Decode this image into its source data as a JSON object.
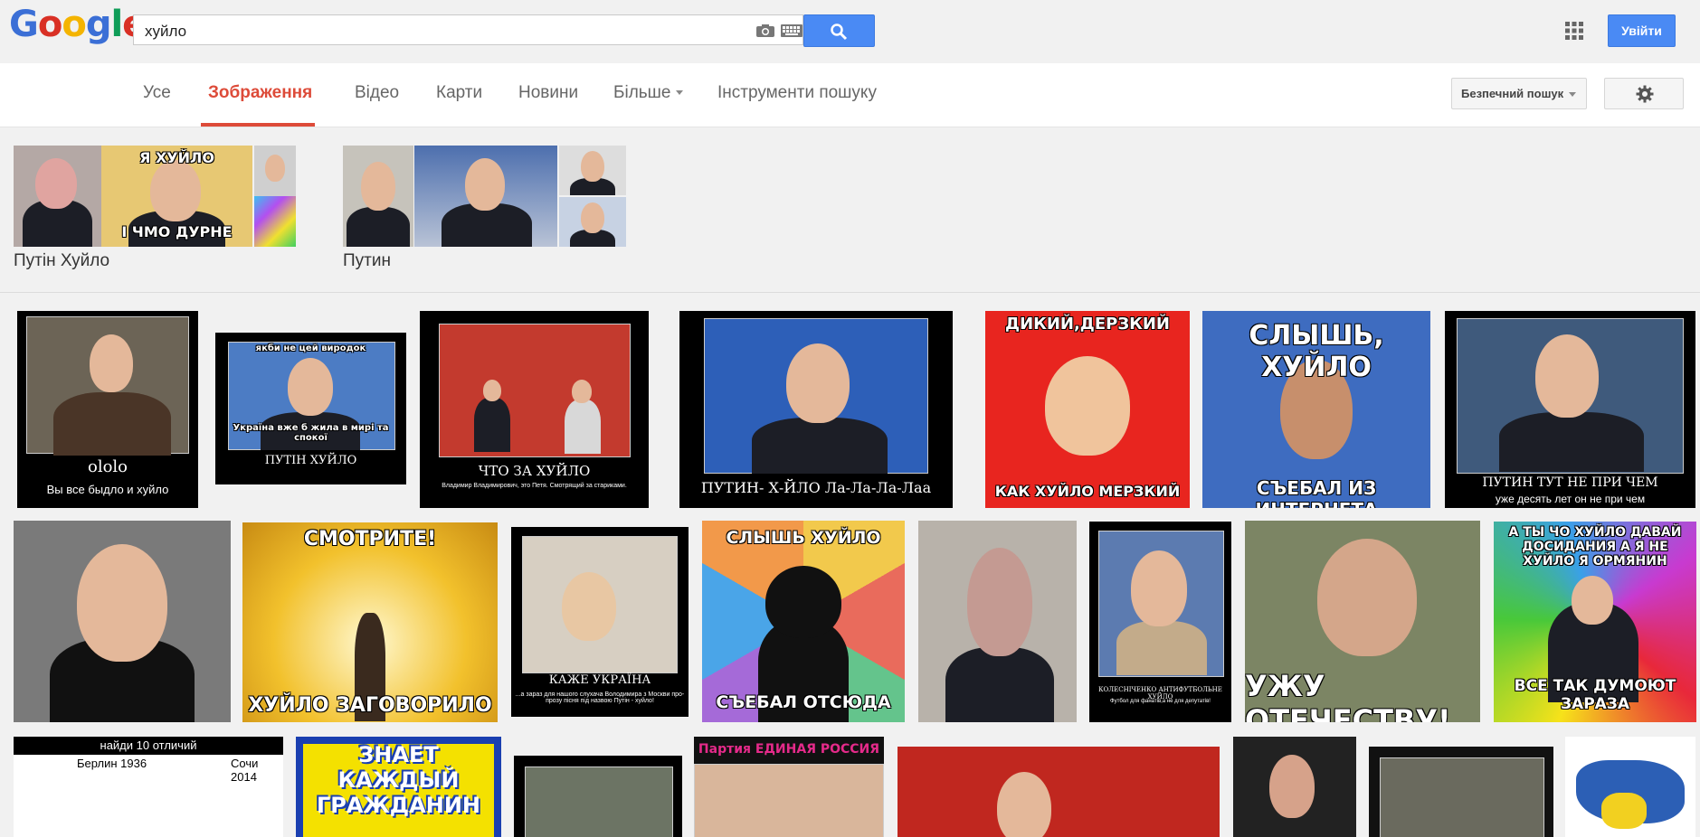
{
  "header": {
    "search_value": "хуйло",
    "login_label": "Увійти"
  },
  "nav": {
    "tabs": [
      {
        "label": "Усе"
      },
      {
        "label": "Зображення"
      },
      {
        "label": "Відео"
      },
      {
        "label": "Карти"
      },
      {
        "label": "Новини"
      },
      {
        "label": "Більше"
      },
      {
        "label": "Інструменти пошуку"
      }
    ],
    "safe_search_label": "Безпечний пошук"
  },
  "related": [
    {
      "label": "Путін Хуйло",
      "caption_top": "Я ХУЙЛО",
      "caption_bottom": "І ЧМО ДУРНЕ"
    },
    {
      "label": "Путин"
    }
  ],
  "results": {
    "r1": {
      "title": "ololo",
      "subtitle": "Вы все быдло и хуйло"
    },
    "r2": {
      "top": "якби не цей виродок",
      "middle": "Україна вже б жила в мирі та спокої",
      "title": "ПУТІН ХУЙЛО"
    },
    "r3": {
      "title": "ЧТО ЗА ХУЙЛО",
      "subtitle": "Владимир Владимирович, это Петя. Смотрящий за стариками."
    },
    "r4": {
      "title": "ПУТИН- Х-ЙЛО Ла-Ла-Ла-Лаа"
    },
    "r5": {
      "top": "ДИКИЙ,ДЕРЗКИЙ",
      "bottom": "КАК ХУЙЛО МЕРЗКИЙ"
    },
    "r6": {
      "top": "СЛЫШЬ, ХУЙЛО",
      "bottom": "СЪЕБАЛ ИЗ ИНТЕРНЕТА"
    },
    "r7": {
      "title": "ПУТИН ТУТ НЕ ПРИ ЧЕМ",
      "subtitle": "уже десять лет он не при чем"
    },
    "r9": {
      "top": "СМОТРИТЕ!",
      "bottom": "ХУЙЛО ЗАГОВОРИЛО"
    },
    "r10": {
      "title": "КАЖЕ УКРАЇНА",
      "subtitle": "...а зараз для нашого слухача Володимира з Москви про-прозу пісня під назвою Путін - хуйло!"
    },
    "r11": {
      "top": "СЛЫШЬ ХУЙЛО",
      "bottom": "СЪЕБАЛ ОТСЮДА"
    },
    "r13": {
      "title": "КОЛЕСНІЧЕНКО АНТИФУТБОЛЬНЕ ХУЙЛО",
      "subtitle": "Футбол для фанатів,а не для депутатів!"
    },
    "r14": {
      "bottom": "УЖУ ОТЕЧЕСТВУ!"
    },
    "r15": {
      "top": "А ТЫ ЧО ХУЙЛО ДАВАЙ ДОСИДАНИЯ А Я НЕ ХУЙЛО Я ОРМЯНИН",
      "bottom": "ВСЕ ТАК ДУМОЮТ ЗАРАЗА"
    },
    "r16": {
      "title": "найди 10 отличий",
      "left": "Берлин 1936",
      "right": "Сочи 2014"
    },
    "r17": {
      "title": "ЗНАЕТ КАЖДЫЙ ГРАЖДАНИН"
    },
    "r19": {
      "title": "Партия ЕДИНАЯ РОССИЯ"
    }
  },
  "colors": {
    "google_blue": "#4a8af4",
    "active_tab": "#dd4b39"
  }
}
